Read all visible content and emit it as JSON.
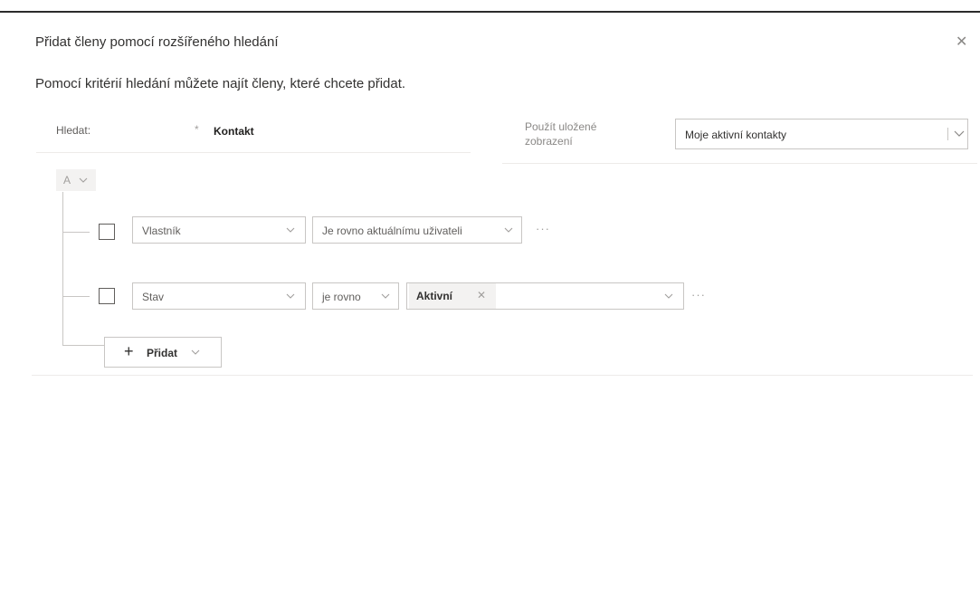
{
  "dialog": {
    "title": "Přidat členy pomocí rozšířeného hledání",
    "close_glyph": "✕",
    "subtitle": "Pomocí kritérií hledání můžete najít členy, které chcete přidat."
  },
  "search": {
    "label": "Hledat:",
    "required_mark": "*",
    "entity": "Kontakt"
  },
  "saved_view": {
    "label": "Použít uložené zobrazení",
    "value": "Moje aktivní kontakty"
  },
  "group": {
    "operator": "A"
  },
  "conditions": [
    {
      "field": "Vlastník",
      "operator": "Je rovno aktuálnímu uživateli"
    },
    {
      "field": "Stav",
      "operator": "je rovno",
      "value_tag": "Aktivní"
    }
  ],
  "more_glyph": "···",
  "add_button": {
    "label": "Přidat",
    "plus": "+"
  },
  "colors": {
    "border": "#c8c6c4",
    "text": "#323130",
    "muted": "#a19f9d",
    "tag_bg": "#f3f2f1"
  }
}
